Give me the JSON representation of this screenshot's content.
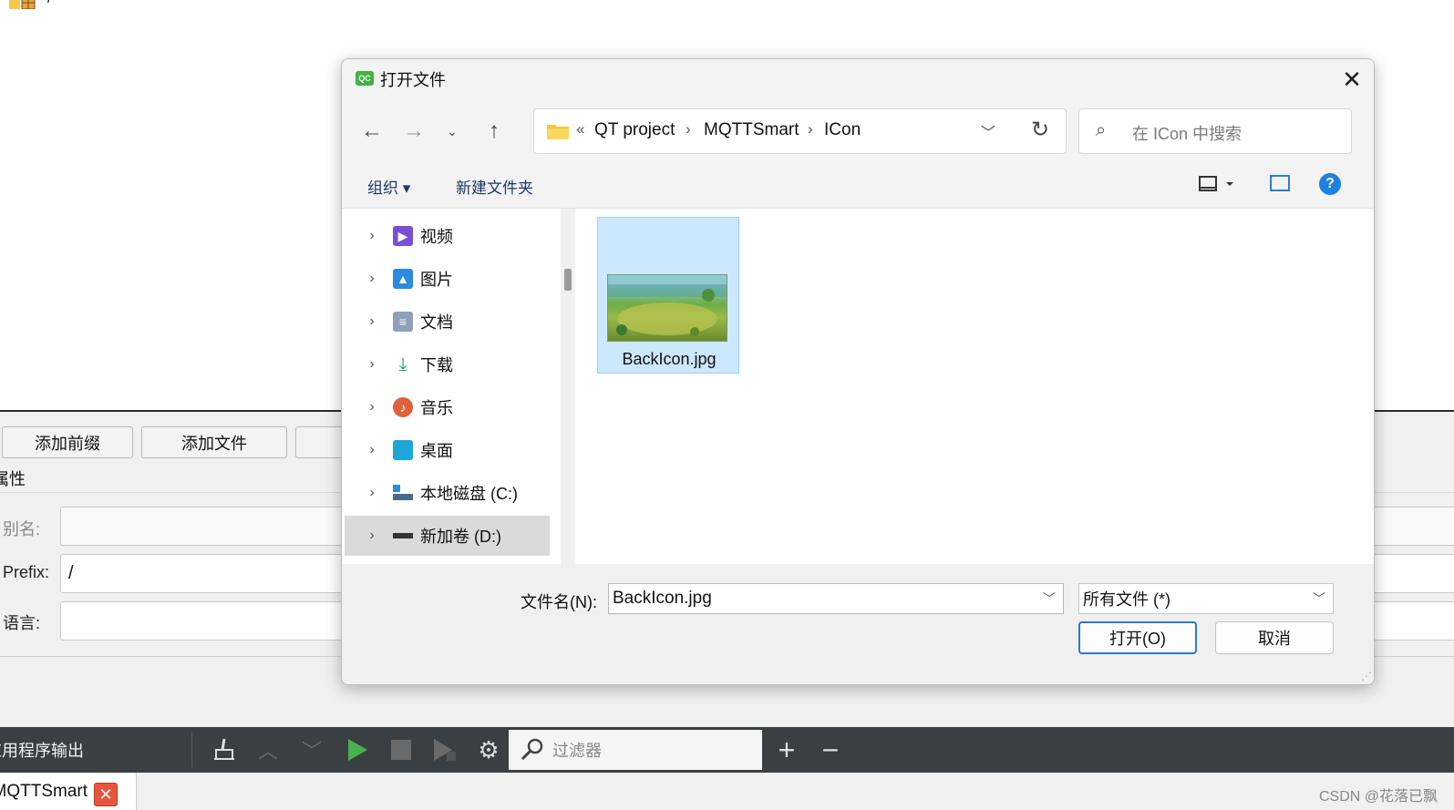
{
  "background": {
    "top_path": "/",
    "buttons": [
      "添加前缀",
      "添加文件"
    ],
    "properties_label": "属性",
    "fields": [
      {
        "label": "别名:",
        "value": ""
      },
      {
        "label": "Prefix:",
        "value": "/"
      },
      {
        "label": "语言:",
        "value": ""
      }
    ],
    "output_label": "应用程序输出",
    "filter_placeholder": "过滤器",
    "project_tab": "MQTTSmart",
    "watermark": "CSDN @花落已飘"
  },
  "dialog": {
    "title": "打开文件",
    "breadcrumb": [
      "QT project",
      "MQTTSmart",
      "ICon"
    ],
    "search_placeholder": "在 ICon 中搜索",
    "commands": {
      "organize": "组织 ▾",
      "new_folder": "新建文件夹"
    },
    "nav_items": [
      {
        "label": "视频",
        "icon": "video-icon",
        "color": "#7a4fd6"
      },
      {
        "label": "图片",
        "icon": "picture-icon",
        "color": "#2a8be0"
      },
      {
        "label": "文档",
        "icon": "document-icon",
        "color": "#8fa0b8"
      },
      {
        "label": "下载",
        "icon": "download-icon",
        "color": "#1aa06a"
      },
      {
        "label": "音乐",
        "icon": "music-icon",
        "color": "#e0603a"
      },
      {
        "label": "桌面",
        "icon": "desktop-icon",
        "color": "#1fa6d8"
      },
      {
        "label": "本地磁盘 (C:)",
        "icon": "drive-c-icon",
        "color": "#4a6a8a"
      },
      {
        "label": "新加卷 (D:)",
        "icon": "drive-d-icon",
        "color": "#333333"
      }
    ],
    "selected_nav_index": 7,
    "files": [
      {
        "name": "BackIcon.jpg"
      }
    ],
    "filename_label": "文件名(N):",
    "filename_value": "BackIcon.jpg",
    "filetype": "所有文件 (*)",
    "open_button": "打开(O)",
    "cancel_button": "取消"
  }
}
